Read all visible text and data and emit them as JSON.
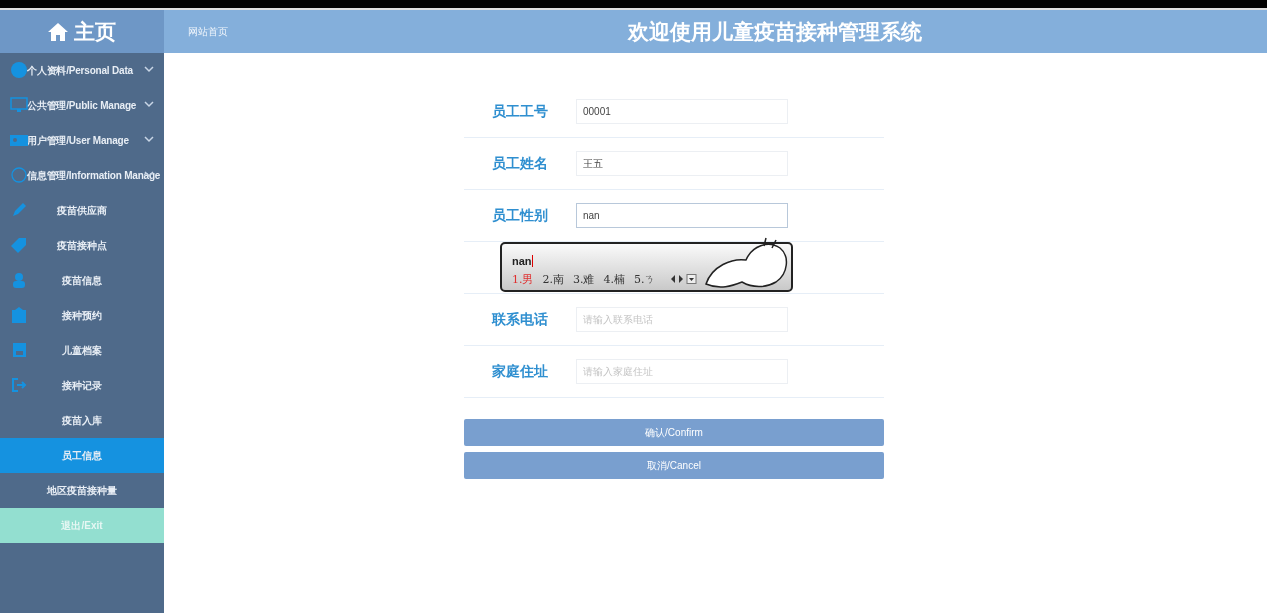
{
  "brand": {
    "title": "主页"
  },
  "header": {
    "breadcrumb": "网站首页",
    "title": "欢迎使用儿童疫苗接种管理系统"
  },
  "sidebar": {
    "items": [
      {
        "kind": "group",
        "label": "个人资料/Personal Data",
        "selected": false
      },
      {
        "kind": "group",
        "label": "公共管理/Public Manage",
        "selected": false
      },
      {
        "kind": "group",
        "label": "用户管理/User Manage",
        "selected": false
      },
      {
        "kind": "group",
        "label": "信息管理/Information Manage",
        "selected": false
      },
      {
        "kind": "item",
        "label": "疫苗供应商",
        "selected": false
      },
      {
        "kind": "item",
        "label": "疫苗接种点",
        "selected": false
      },
      {
        "kind": "item",
        "label": "疫苗信息",
        "selected": false
      },
      {
        "kind": "item",
        "label": "接种预约",
        "selected": false
      },
      {
        "kind": "item",
        "label": "儿童档案",
        "selected": false
      },
      {
        "kind": "item",
        "label": "接种记录",
        "selected": false
      },
      {
        "kind": "item",
        "label": "疫苗入库",
        "selected": false
      },
      {
        "kind": "item",
        "label": "员工信息",
        "selected": true
      },
      {
        "kind": "item",
        "label": "地区疫苗接种量",
        "selected": false
      },
      {
        "kind": "exit",
        "label": "退出/Exit",
        "selected": false
      }
    ]
  },
  "form": {
    "rows": [
      {
        "label": "员工工号",
        "value": "00001",
        "focused": false
      },
      {
        "label": "员工姓名",
        "value": "王五",
        "focused": false
      },
      {
        "label": "员工性别",
        "value": "nan",
        "focused": true
      },
      {},
      {
        "label": "联系电话",
        "placeholder": "请输入联系电话",
        "focused": false
      },
      {
        "label": "家庭住址",
        "placeholder": "请输入家庭住址",
        "focused": false
      }
    ],
    "buttons": [
      "确认/Confirm",
      "取消/Cancel"
    ]
  },
  "ime": {
    "composition": "nan",
    "candidates": [
      {
        "text": "1.男",
        "selected": true
      },
      {
        "text": "2.南",
        "selected": false
      },
      {
        "text": "3.难",
        "selected": false
      },
      {
        "text": "4.楠",
        "selected": false
      },
      {
        "text": "5.ㄋ",
        "selected": false
      }
    ]
  }
}
